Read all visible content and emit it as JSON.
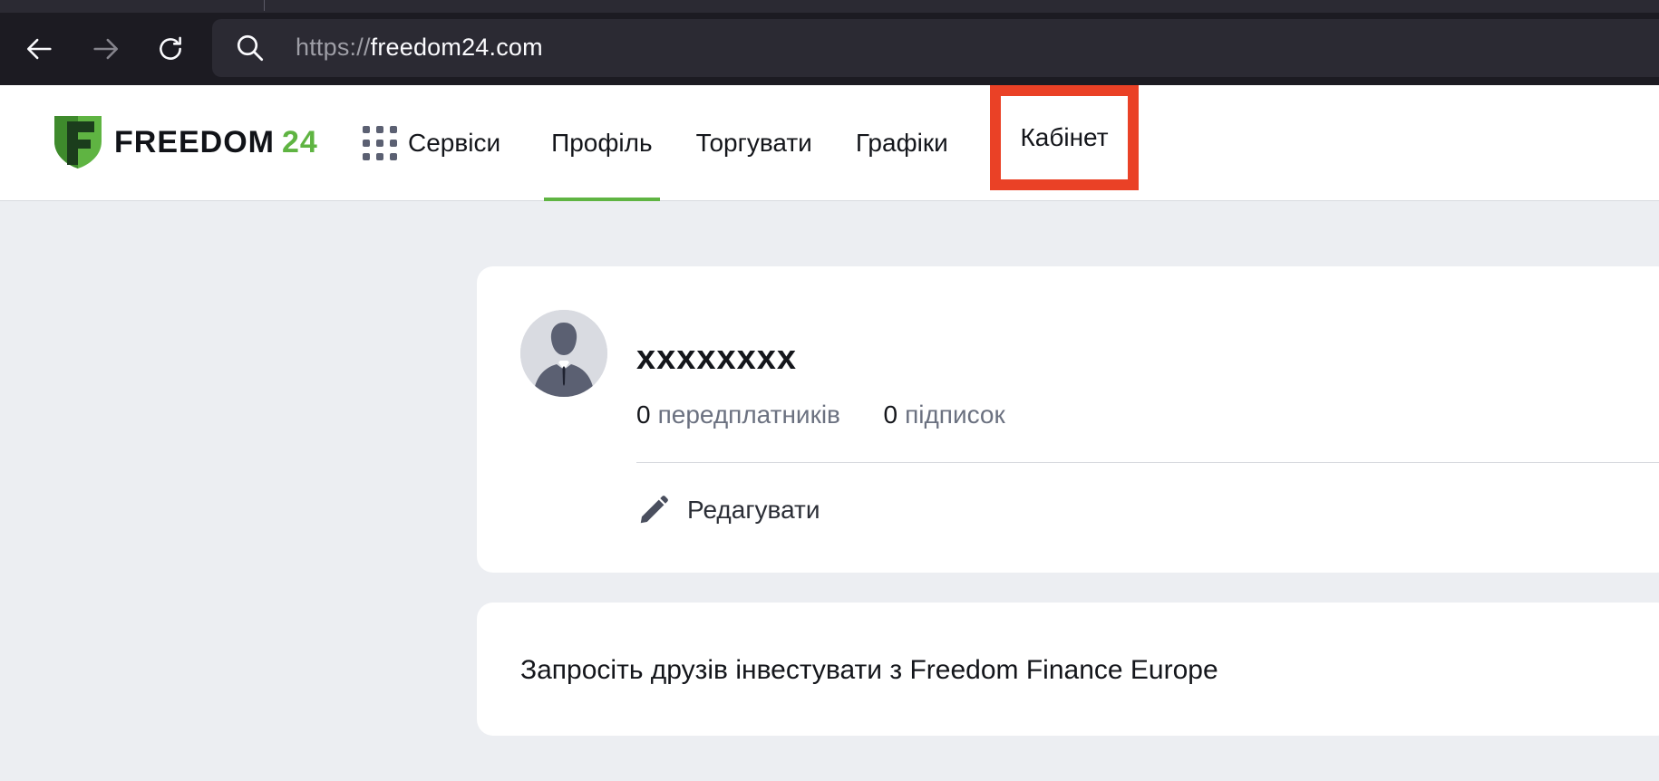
{
  "browser": {
    "url_scheme": "https://",
    "url_host": "freedom24.com",
    "back_icon": "arrow-left-icon",
    "forward_icon": "arrow-right-icon",
    "reload_icon": "reload-icon",
    "search_icon": "search-icon"
  },
  "header": {
    "logo": {
      "word": "FREEDOM",
      "number": "24"
    },
    "nav": {
      "services": "Сервіси",
      "profile": "Профіль",
      "trade": "Торгувати",
      "charts": "Графіки",
      "cabinet": "Кабінет"
    },
    "active_tab": "Профіль",
    "highlight_color": "#ea4126",
    "accent_color": "#5fb442"
  },
  "profile": {
    "name": "xxxxxxxx",
    "subscribers_count": "0",
    "subscribers_label": "передплатників",
    "subscriptions_count": "0",
    "subscriptions_label": "підписок",
    "edit_label": "Редагувати"
  },
  "invite": {
    "text": "Запросіть друзів інвестувати з Freedom Finance Europe"
  }
}
